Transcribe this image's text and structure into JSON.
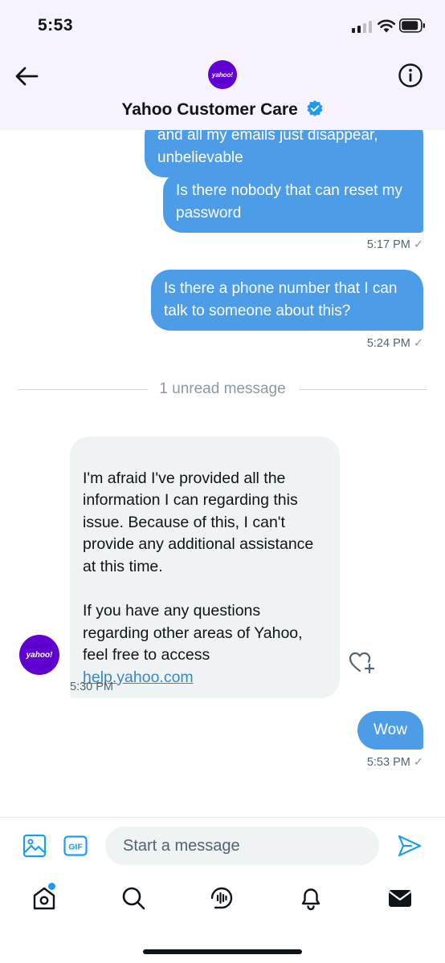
{
  "status_bar": {
    "time": "5:53"
  },
  "header": {
    "back_icon": "arrow-left-icon",
    "avatar_text": "yahoo!",
    "title": "Yahoo Customer Care",
    "verified_icon": "verified-badge-icon",
    "info_icon": "info-icon"
  },
  "messages": [
    {
      "direction": "out",
      "text": "and all my emails just disappear, unbelievable"
    },
    {
      "direction": "out",
      "text": "Is there nobody that can reset my password",
      "time": "5:17 PM",
      "status": "✓"
    },
    {
      "direction": "out",
      "text": "Is there a phone number that I can talk to someone about this?",
      "time": "5:24 PM",
      "status": "✓"
    },
    {
      "direction": "in",
      "text": "I'm afraid I've provided all the information I can regarding this issue. Because of this, I  can't provide any additional assistance at this time.\n\nIf you have any questions regarding other areas of Yahoo, feel free to access",
      "link": "help.yahoo.com",
      "avatar_text": "yahoo!",
      "time": "5:30 PM"
    },
    {
      "direction": "out",
      "text": "Wow",
      "time": "5:53 PM",
      "status": "✓"
    }
  ],
  "unread_divider": "1 unread message",
  "composer": {
    "placeholder": "Start a message",
    "value": "",
    "gif_label": "GIF",
    "media_icon": "image-icon",
    "send_icon": "send-icon"
  },
  "tabbar": {
    "items": [
      "home-icon",
      "search-icon",
      "spaces-icon",
      "notifications-icon",
      "messages-icon"
    ]
  },
  "colors": {
    "accent": "#1d9bf0",
    "bubble_out": "#4c9ce8",
    "bubble_in": "#eff3f4",
    "yahoo_purple": "#6001d2",
    "header_bg": "#f7f3fd"
  }
}
